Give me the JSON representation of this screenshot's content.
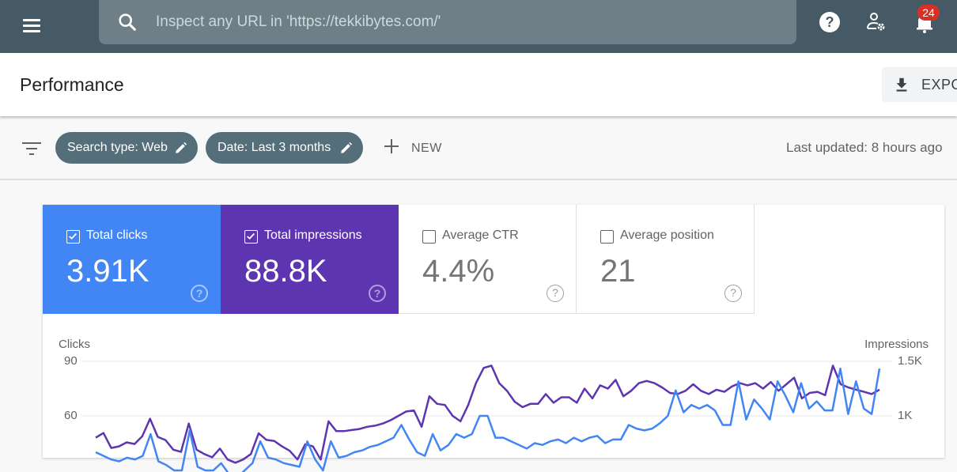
{
  "topbar": {
    "search_placeholder": "Inspect any URL in 'https://tekkibytes.com/'",
    "notifications_count": "24",
    "icons": [
      "menu-icon",
      "search-icon",
      "help-icon",
      "manage-users-icon",
      "notifications-bell-icon"
    ]
  },
  "header": {
    "title": "Performance",
    "export_label": "EXPO"
  },
  "filters": {
    "chips": [
      {
        "label": "Search type: Web"
      },
      {
        "label": "Date: Last 3 months"
      }
    ],
    "new_label": "NEW",
    "last_updated": "Last updated: 8 hours ago"
  },
  "metrics": [
    {
      "label": "Total clicks",
      "value": "3.91K",
      "checked": true,
      "color": "#4285f4"
    },
    {
      "label": "Total impressions",
      "value": "88.8K",
      "checked": true,
      "color": "#5e35b1"
    },
    {
      "label": "Average CTR",
      "value": "4.4%",
      "checked": false
    },
    {
      "label": "Average position",
      "value": "21",
      "checked": false
    }
  ],
  "help_glyph": "?",
  "chart_data": {
    "type": "line",
    "left_axis": {
      "title": "Clicks",
      "ticks": [
        "90",
        "60"
      ],
      "tick_values": [
        90,
        60
      ]
    },
    "right_axis": {
      "title": "Impressions",
      "ticks": [
        "1.5K",
        "1K"
      ],
      "tick_values": [
        1500,
        1000
      ]
    },
    "grid": true,
    "series": [
      {
        "name": "Impressions",
        "axis": "right",
        "color": "#5e35b1",
        "values": [
          800,
          843,
          706,
          720,
          757,
          742,
          814,
          974,
          807,
          778,
          690,
          670,
          930,
          690,
          650,
          620,
          700,
          600,
          570,
          600,
          650,
          840,
          780,
          770,
          720,
          680,
          600,
          740,
          720,
          600,
          950,
          860,
          860,
          870,
          880,
          900,
          910,
          930,
          960,
          1000,
          1040,
          1050,
          900,
          1180,
          1110,
          1100,
          1000,
          950,
          1100,
          1300,
          1440,
          1460,
          1300,
          1230,
          1130,
          1080,
          1110,
          1110,
          1200,
          1120,
          1170,
          1170,
          1120,
          1250,
          1160,
          1280,
          1250,
          1330,
          1180,
          1230,
          1300,
          1320,
          1300,
          1260,
          1210,
          1200,
          1230,
          1290,
          1230,
          1200,
          1240,
          1220,
          1270,
          1300,
          1280,
          1300,
          1250,
          1310,
          1230,
          1290,
          1350,
          1160,
          1210,
          1220,
          1190,
          1460,
          1290,
          1260,
          1240,
          1220,
          1200,
          1240
        ]
      },
      {
        "name": "Clicks",
        "axis": "left",
        "color": "#4285f4",
        "values": [
          40,
          38,
          36,
          35,
          37,
          36,
          38,
          50,
          35,
          33,
          30,
          30,
          52,
          32,
          30,
          30,
          34,
          28,
          26,
          30,
          34,
          46,
          37,
          36,
          34,
          33,
          32,
          46,
          36,
          30,
          46,
          37,
          38,
          40,
          41,
          43,
          44,
          46,
          48,
          55,
          47,
          40,
          38,
          50,
          41,
          44,
          50,
          48,
          50,
          60,
          60,
          48,
          48,
          46,
          44,
          42,
          45,
          44,
          46,
          47,
          45,
          48,
          46,
          48,
          49,
          45,
          47,
          47,
          55,
          53,
          52,
          53,
          56,
          60,
          74,
          62,
          66,
          64,
          66,
          63,
          55,
          55,
          79,
          58,
          69,
          64,
          58,
          79,
          71,
          62,
          78,
          64,
          68,
          63,
          63,
          86,
          61,
          79,
          64,
          61,
          86
        ]
      }
    ]
  }
}
